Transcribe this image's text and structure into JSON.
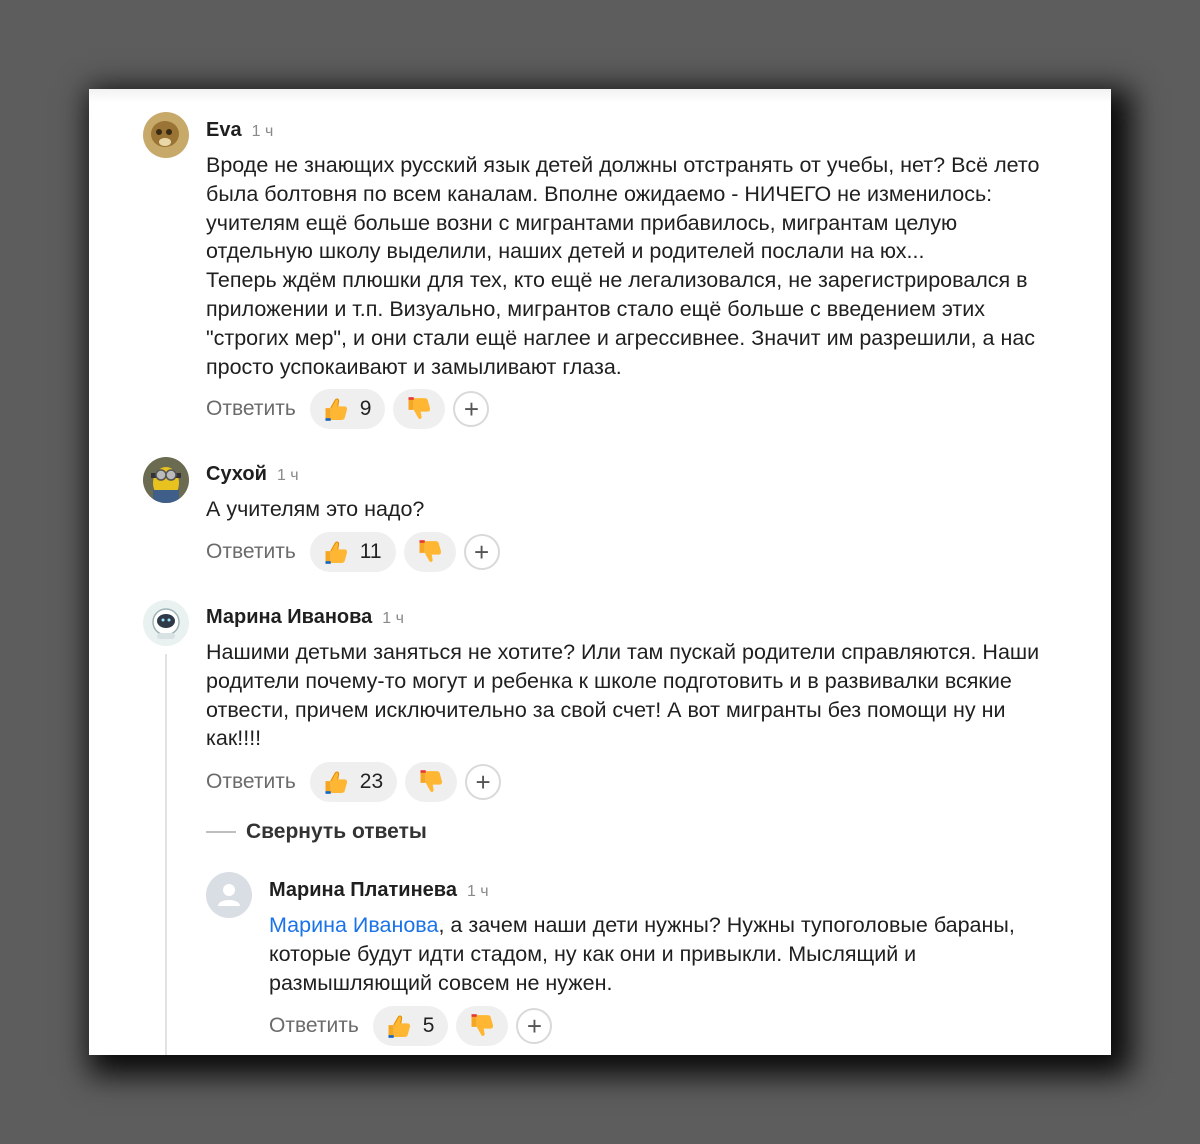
{
  "comments": [
    {
      "author": "Eva",
      "time": "1 ч",
      "text_lines": [
        "Вроде не знающих русский язык детей должны отстранять от учебы, нет? Всё лето",
        "была болтовня по всем каналам. Вполне ожидаемо - НИЧЕГО не изменилось:",
        "учителям ещё больше возни с мигрантами прибавилось, мигрантам целую",
        "отдельную школу выделили, наших детей и родителей послали на юх...",
        "Теперь ждём плюшки для тех, кто ещё не легализовался, не зарегистрировался в",
        "приложении и т.п. Визуально, мигрантов стало ещё больше с введением этих",
        "\"строгих мер\", и они стали ещё наглее и агрессивнее. Значит им разрешили, а нас",
        "просто успокаивают и замыливают глаза."
      ],
      "reply_label": "Ответить",
      "likes": "9"
    },
    {
      "author": "Сухой",
      "time": "1 ч",
      "text_lines": [
        "А учителям это надо?"
      ],
      "reply_label": "Ответить",
      "likes": "11"
    },
    {
      "author": "Марина Иванова",
      "time": "1 ч",
      "text_lines": [
        "Нашими детьми заняться не хотите? Или там пускай родители справляются. Наши",
        "родители почему-то могут и ребенка к школе подготовить и в развивалки всякие",
        "отвести, причем исключительно за свой счет! А вот мигранты без помощи ну ни",
        "как!!!!"
      ],
      "reply_label": "Ответить",
      "likes": "23"
    }
  ],
  "collapse_label": "Свернуть ответы",
  "reply": {
    "author": "Марина Платинева",
    "time": "1 ч",
    "mention": "Марина Иванова",
    "text_first": ", а зачем наши дети нужны? Нужны тупоголовые бараны,",
    "text_lines": [
      "которые будут идти стадом, ну как они и привыкли. Мыслящий и",
      "размышляющий совсем не нужен."
    ],
    "reply_label": "Ответить",
    "likes": "5"
  },
  "icons": {
    "like": "thumbs-up-icon",
    "dislike": "thumbs-down-icon",
    "add": "plus-icon"
  },
  "colors": {
    "mention": "#1a73e8",
    "reaction_pill": "#efefef",
    "page_frame": "#5d5d5d"
  }
}
